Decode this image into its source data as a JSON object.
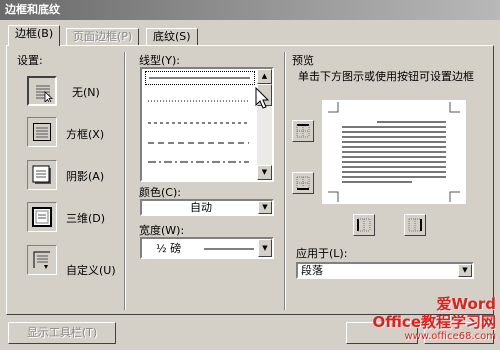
{
  "window": {
    "title": "边框和底纹"
  },
  "tabs": [
    {
      "label": "边框(B)"
    },
    {
      "label": "页面边框(P)"
    },
    {
      "label": "底纹(S)"
    }
  ],
  "settings": {
    "heading": "设置:",
    "options": [
      {
        "label": "无(N)",
        "icon": "none-border-icon",
        "selected": true
      },
      {
        "label": "方框(X)",
        "icon": "box-border-icon"
      },
      {
        "label": "阴影(A)",
        "icon": "shadow-border-icon"
      },
      {
        "label": "三维(D)",
        "icon": "3d-border-icon"
      },
      {
        "label": "自定义(U)",
        "icon": "custom-border-icon"
      }
    ]
  },
  "line_style": {
    "label": "线型(Y):",
    "options": [
      "solid",
      "dotted",
      "dashed-short",
      "dashed",
      "dash-dot",
      "dash-dot-dot"
    ],
    "selected": 0
  },
  "color": {
    "label": "颜色(C):",
    "value": "自动"
  },
  "width": {
    "label": "宽度(W):",
    "value": "½ 磅"
  },
  "preview": {
    "heading": "预览",
    "hint": "单击下方图示或使用按钮可设置边框"
  },
  "apply_to": {
    "label": "应用于(L):",
    "value": "段落"
  },
  "footer": {
    "toolbar_button": "显示工具栏(T)"
  },
  "watermark": {
    "line1": "爱Word",
    "line2": "Office教程学习网",
    "line3": "www.office68.com"
  },
  "colors": {
    "dialog_bg": "#d4d0c8",
    "watermark_red": "#e0201a"
  }
}
